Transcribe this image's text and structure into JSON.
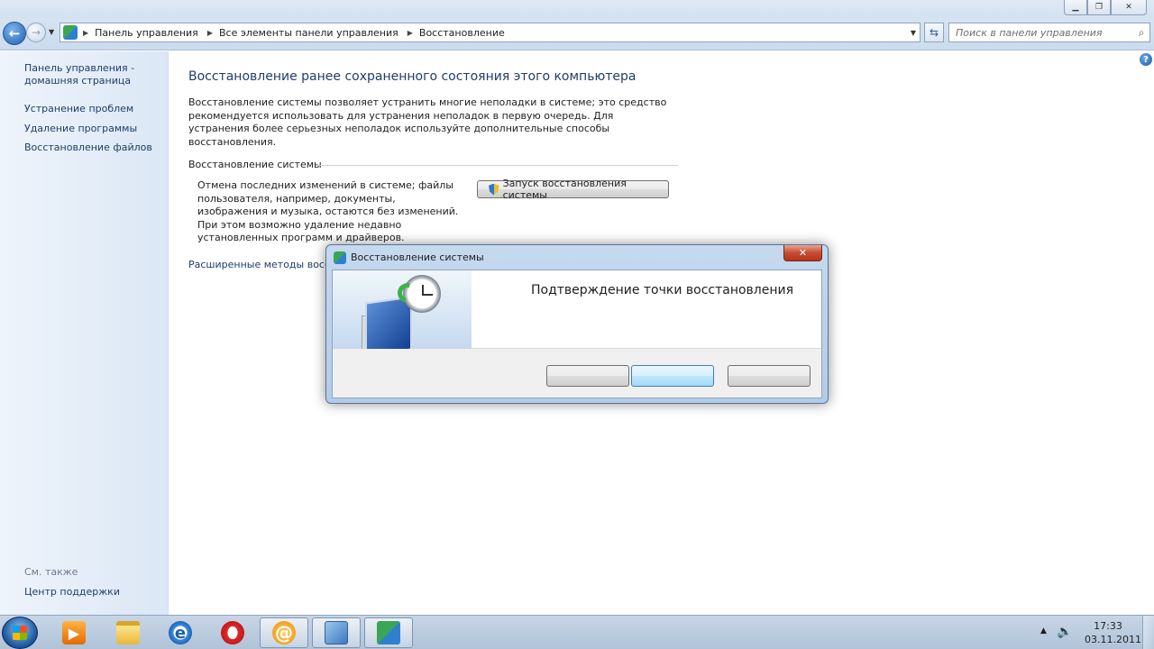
{
  "window": {
    "minimize_glyph": "▁",
    "maximize_glyph": "❐",
    "close_glyph": "✕"
  },
  "address_bar": {
    "back_glyph": "←",
    "forward_glyph": "→",
    "recent_glyph": "▼",
    "breadcrumbs": [
      "Панель управления",
      "Все элементы панели управления",
      "Восстановление"
    ],
    "separator_glyph": "▶",
    "dropdown_glyph": "▼",
    "refresh_glyph": "⇆",
    "search_placeholder": "Поиск в панели управления",
    "search_glyph": "⌕"
  },
  "sidebar": {
    "home_line1": "Панель управления -",
    "home_line2": "домашняя страница",
    "links": [
      "Устранение проблем",
      "Удаление программы",
      "Восстановление файлов"
    ],
    "see_also": "См. также",
    "support_center": "Центр поддержки"
  },
  "main": {
    "help_glyph": "?",
    "title": "Восстановление ранее сохраненного состояния этого компьютера",
    "description": "Восстановление системы позволяет устранить многие неполадки в системе; это средство рекомендуется использовать для устранения неполадок в первую очередь. Для устранения более серьезных неполадок используйте дополнительные способы восстановления.",
    "section_title": "Восстановление системы",
    "section_description": "Отмена последних изменений в системе; файлы пользователя, например, документы, изображения и музыка, остаются без изменений. При этом возможно удаление недавно установленных программ и драйверов.",
    "launch_button": "Запуск восстановления системы",
    "advanced_link": "Расширенные методы восста"
  },
  "dialog": {
    "title": "Восстановление системы",
    "close_glyph": "✕",
    "heading": "Подтверждение точки восстановления",
    "buttons": [
      "",
      "",
      ""
    ]
  },
  "taskbar": {
    "apps": [
      {
        "name": "windows-media-player",
        "glyph": "▶"
      },
      {
        "name": "windows-explorer",
        "glyph": ""
      },
      {
        "name": "internet-explorer",
        "glyph": "e"
      },
      {
        "name": "opera",
        "glyph": ""
      },
      {
        "name": "mail-agent",
        "glyph": "@"
      },
      {
        "name": "control-panel",
        "glyph": ""
      },
      {
        "name": "system-restore",
        "glyph": ""
      }
    ],
    "tray_arrow": "▲",
    "volume_glyph": "🔈",
    "time": "17:33",
    "date": "03.11.2011"
  }
}
